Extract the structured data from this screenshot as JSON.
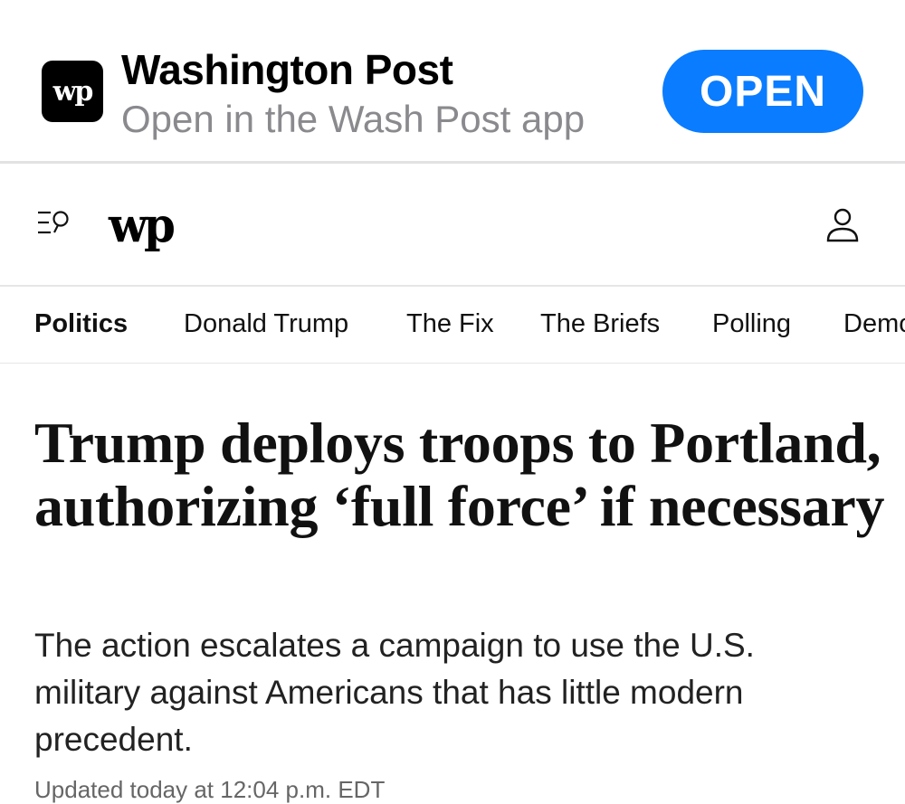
{
  "banner": {
    "app_icon_text": "wp",
    "app_name": "Washington Post",
    "app_subtitle": "Open in the Wash Post app",
    "open_label": "OPEN"
  },
  "header": {
    "logo": "wp",
    "menu_icon": "menu-search-icon",
    "account_icon": "user-icon"
  },
  "nav": {
    "items": [
      "Politics",
      "Donald Trump",
      "The Fix",
      "The Briefs",
      "Polling",
      "Democracy"
    ],
    "active": "Politics"
  },
  "article": {
    "headline": "Trump deploys troops to Portland, authorizing ‘full force’ if necessary",
    "dek": "The action escalates a campaign to use the U.S. military against Americans that has little modern precedent.",
    "timestamp": "Updated today at 12:04 p.m. EDT"
  }
}
